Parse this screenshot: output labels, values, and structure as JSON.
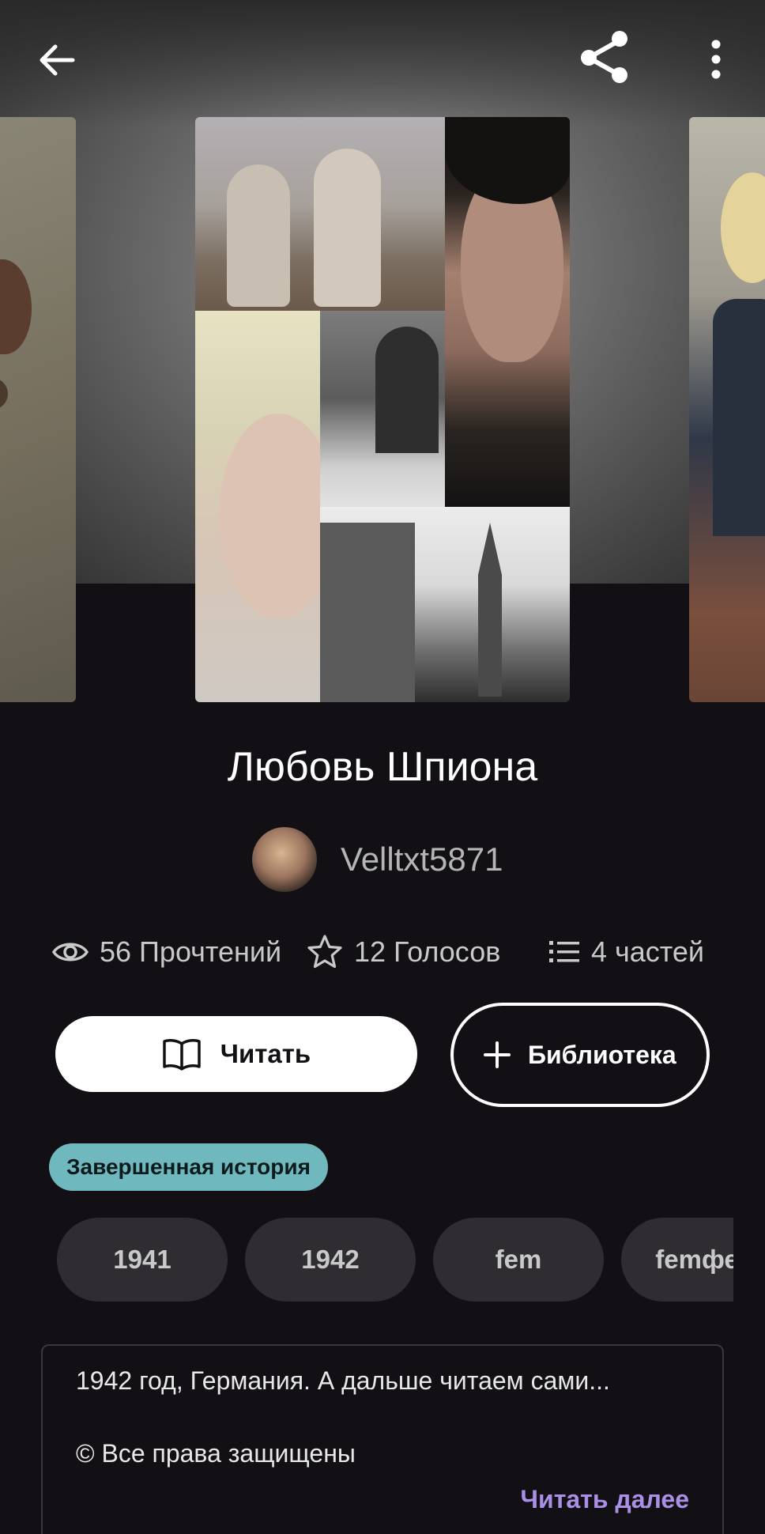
{
  "story": {
    "title": "Любовь Шпиона",
    "author": "Velltxt5871",
    "status": "Завершенная история",
    "description": "1942 год, Германия. А дальше читаем сами...",
    "rights": "© Все права защищены",
    "read_more": "Читать далее"
  },
  "stats": {
    "reads": "56 Прочтений",
    "votes": "12 Голосов",
    "parts": "4 частей"
  },
  "actions": {
    "read_label": "Читать",
    "library_label": "Библиотека"
  },
  "tags": [
    "1941",
    "1942",
    "fem",
    "femфем"
  ],
  "icons": {
    "back": "arrow-left-icon",
    "share": "share-icon",
    "more": "more-vertical-icon",
    "reads": "eye-icon",
    "votes": "star-icon",
    "parts": "list-icon",
    "read": "book-open-icon",
    "library": "plus-icon"
  },
  "colors": {
    "background": "#121014",
    "status_badge": "#6fb9be",
    "read_more": "#a98fe6",
    "tag_bg": "#2f2d31"
  }
}
